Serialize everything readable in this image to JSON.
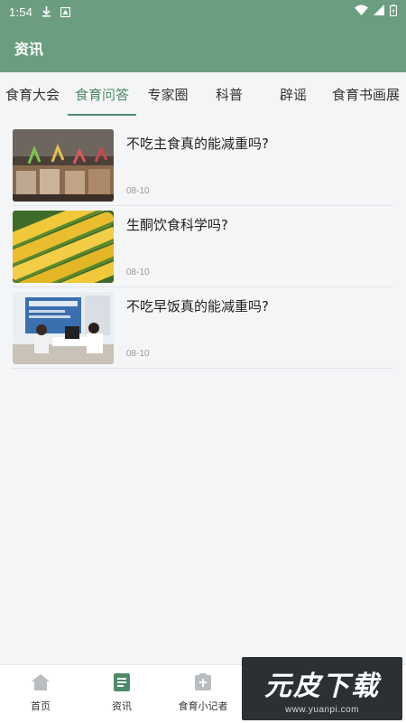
{
  "status_bar": {
    "time": "1:54",
    "left_icons": [
      "download-icon",
      "notification-icon"
    ],
    "right_icons": [
      "wifi-icon",
      "signal-icon",
      "battery-icon"
    ]
  },
  "app_bar": {
    "title": "资讯"
  },
  "tabs": [
    {
      "label": "食育大会",
      "active": false
    },
    {
      "label": "食育问答",
      "active": true
    },
    {
      "label": "专家圈",
      "active": false
    },
    {
      "label": "科普",
      "active": false
    },
    {
      "label": "辟谣",
      "active": false
    },
    {
      "label": "食育书画展",
      "active": false
    }
  ],
  "articles": [
    {
      "title": "不吃主食真的能减重吗?",
      "date": "08-10",
      "thumbnail": "dessert-cups-photo"
    },
    {
      "title": "生酮饮食科学吗?",
      "date": "08-10",
      "thumbnail": "corn-photo"
    },
    {
      "title": "不吃早饭真的能减重吗?",
      "date": "08-10",
      "thumbnail": "consultation-photo"
    }
  ],
  "bottom_nav": [
    {
      "label": "首页",
      "icon": "home-icon",
      "active": false
    },
    {
      "label": "资讯",
      "icon": "news-icon",
      "active": true
    },
    {
      "label": "食育小记者",
      "icon": "reporter-icon",
      "active": false
    }
  ],
  "watermark": {
    "logo": "元皮下载",
    "url": "www.yuanpi.com"
  },
  "colors": {
    "primary": "#6b9e80",
    "tab_active": "#4f8a6a",
    "background": "#f4f5f7"
  }
}
